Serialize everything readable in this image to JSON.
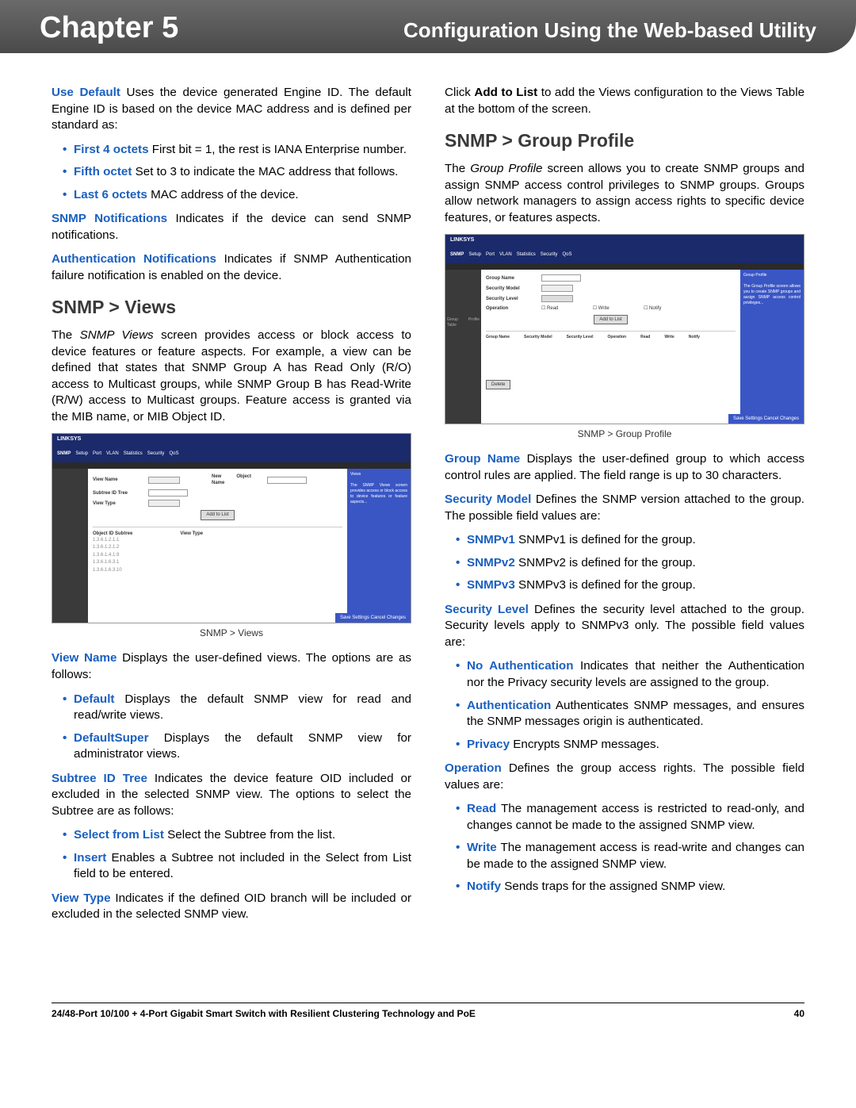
{
  "header": {
    "chapter": "Chapter 5",
    "title": "Configuration Using the Web-based Utility"
  },
  "left": {
    "p1_term": "Use Default",
    "p1_rest": "  Uses the device generated Engine ID. The default Engine ID is based on the device MAC address and is defined per standard as:",
    "b1_term": "First 4 octets",
    "b1_rest": "  First bit = 1, the rest is IANA Enterprise number.",
    "b2_term": "Fifth octet",
    "b2_rest": "  Set to 3 to indicate the MAC address that follows.",
    "b3_term": "Last 6 octets",
    "b3_rest": "  MAC address of the device.",
    "p2_term": "SNMP Notifications",
    "p2_rest": "  Indicates if the device can send SNMP notifications.",
    "p3_term": "Authentication Notifications",
    "p3_rest": " Indicates if SNMP Authentication failure notification is enabled on the device.",
    "h_views": "SNMP > Views",
    "views_intro_pre": "The ",
    "views_intro_em": "SNMP Views",
    "views_intro_post": " screen provides access or block access to device features or feature aspects. For example, a view can be defined that states that SNMP Group A has Read Only (R/O) access to Multicast groups, while SNMP Group B has Read-Write (R/W) access to Multicast groups. Feature access is granted via the MIB name, or MIB Object ID.",
    "caption_views": "SNMP >  Views",
    "vn_term": "View Name",
    "vn_rest": "  Displays the user-defined views. The options are as follows:",
    "vn_b1_term": "Default",
    "vn_b1_rest": "  Displays the default SNMP view for read and read/write views.",
    "vn_b2_term": "DefaultSuper",
    "vn_b2_rest": "  Displays the default SNMP view for administrator views.",
    "st_term": "Subtree ID Tree",
    "st_rest": "   Indicates the device feature OID included or excluded in the selected SNMP view. The options to select the Subtree are as follows:",
    "st_b1_term": "Select from List",
    "st_b1_rest": "  Select the Subtree from the list.",
    "st_b2_term": "Insert",
    "st_b2_rest": "  Enables a Subtree not included in the Select from List field to be entered.",
    "vt_term": "View Type",
    "vt_rest": "  Indicates if the defined OID branch will be included or excluded in the selected SNMP view."
  },
  "right": {
    "p1_pre": "Click ",
    "p1_bold": "Add to List",
    "p1_post": " to add the Views configuration to the Views Table at the bottom of the screen.",
    "h_group": "SNMP > Group Profile",
    "gp_intro_pre": "The ",
    "gp_intro_em": "Group Profile",
    "gp_intro_post": " screen allows you to create SNMP groups and assign SNMP access control privileges to SNMP groups. Groups allow network managers to assign access rights to specific device features, or features aspects.",
    "caption_group": "SNMP >  Group Profile",
    "gn_term": "Group Name",
    "gn_rest": "  Displays the user-defined group to which access control rules are applied. The field range is up to 30 characters.",
    "sm_term": "Security Model",
    "sm_rest": "  Defines the SNMP version attached to the group. The possible field values are:",
    "sm_b1_term": "SNMPv1",
    "sm_b1_rest": "  SNMPv1 is defined for the group.",
    "sm_b2_term": "SNMPv2",
    "sm_b2_rest": "  SNMPv2 is defined for the group.",
    "sm_b3_term": "SNMPv3",
    "sm_b3_rest": "  SNMPv3 is defined for the group.",
    "sl_term": "Security Level",
    "sl_rest": "  Defines the security level attached to the group. Security levels apply to SNMPv3 only. The possible field values are:",
    "sl_b1_term": "No Authentication",
    "sl_b1_rest": " Indicates that neither the Authentication nor the Privacy security levels are assigned to the group.",
    "sl_b2_term": "Authentication",
    "sl_b2_rest": "  Authenticates SNMP messages, and ensures the SNMP messages origin is authenticated.",
    "sl_b3_term": "Privacy",
    "sl_b3_rest": "  Encrypts SNMP messages.",
    "op_term": "Operation",
    "op_rest": "  Defines the group access rights. The possible field values are:",
    "op_b1_term": "Read",
    "op_b1_rest": "  The management access is restricted to read-only, and changes cannot be made to the assigned SNMP view.",
    "op_b2_term": "Write",
    "op_b2_rest": "  The management access is read-write and changes can be made to the assigned SNMP view.",
    "op_b3_term": "Notify",
    "op_b3_rest": "  Sends traps for the assigned SNMP view."
  },
  "footer": {
    "product": "24/48-Port 10/100 + 4-Port Gigabit Smart Switch with Resilient Clustering Technology and PoE",
    "page": "40"
  },
  "ss": {
    "brand": "LINKSYS",
    "tab": "SNMP",
    "save": "Save Settings  Cancel Changes",
    "addlist": "Add to List",
    "views": {
      "l1": "View Name",
      "l2": "Subtree ID Tree",
      "l3": "View Type",
      "nb": "New Object Name",
      "head1": "Object ID Subtree",
      "head2": "View Type"
    },
    "group": {
      "l1": "Group Name",
      "l2": "Security Model",
      "l3": "Security Level",
      "l4": "Operation",
      "th": "Group Profile Table",
      "c1": "Group Name",
      "c2": "Security Model",
      "c3": "Security Level",
      "c4": "Operation",
      "c5": "Read",
      "c6": "Write",
      "c7": "Notify"
    }
  }
}
